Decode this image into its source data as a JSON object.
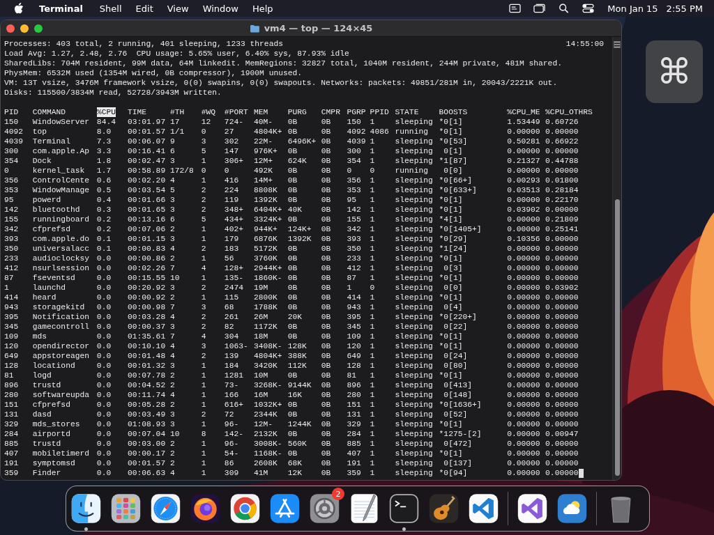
{
  "menubar": {
    "app": "Terminal",
    "menus": [
      "Shell",
      "Edit",
      "View",
      "Window",
      "Help"
    ],
    "date": "Mon Jan 15",
    "time": "2:55 PM"
  },
  "window": {
    "title": "vm4 — top — 124×45"
  },
  "terminal": {
    "summary": [
      "Processes: 403 total, 2 running, 401 sleeping, 1233 threads",
      "Load Avg: 1.27, 2.48, 2.76  CPU usage: 5.65% user, 6.40% sys, 87.93% idle",
      "SharedLibs: 704M resident, 99M data, 64M linkedit. MemRegions: 32827 total, 1040M resident, 244M private, 481M shared.",
      "PhysMem: 6532M used (1354M wired, 0B compressor), 1900M unused.",
      "VM: 13T vsize, 3476M framework vsize, 0(0) swapins, 0(0) swapouts. Networks: packets: 49851/281M in, 20043/2221K out.",
      "Disks: 115500/3834M read, 52728/3943M written."
    ],
    "clock": "14:55:00",
    "columns": [
      {
        "label": "PID",
        "selected": false
      },
      {
        "label": "COMMAND",
        "selected": false
      },
      {
        "label": "%CPU",
        "selected": true
      },
      {
        "label": "TIME",
        "selected": false
      },
      {
        "label": "#TH",
        "selected": false
      },
      {
        "label": "#WQ",
        "selected": false
      },
      {
        "label": "#PORT",
        "selected": false
      },
      {
        "label": "MEM",
        "selected": false
      },
      {
        "label": "PURG",
        "selected": false
      },
      {
        "label": "CMPR",
        "selected": false
      },
      {
        "label": "PGRP",
        "selected": false
      },
      {
        "label": "PPID",
        "selected": false
      },
      {
        "label": "STATE",
        "selected": false
      },
      {
        "label": "BOOSTS",
        "selected": false
      },
      {
        "label": "%CPU_ME",
        "selected": false
      },
      {
        "label": "%CPU_OTHRS",
        "selected": false
      }
    ],
    "rows": [
      [
        "150",
        "WindowServer",
        "84.4",
        "03:01.97",
        "17",
        "12",
        "724-",
        "40M-",
        "0B",
        "0B",
        "150",
        "1",
        "sleeping",
        "*0[1]",
        "1.53449",
        "0.60726"
      ],
      [
        "4092",
        "top",
        "8.0",
        "00:01.57",
        "1/1",
        "0",
        "27",
        "4804K+",
        "0B",
        "0B",
        "4092",
        "4086",
        "running",
        "*0[1]",
        "0.00000",
        "0.00000"
      ],
      [
        "4039",
        "Terminal",
        "7.3",
        "00:06.07",
        "9",
        "3",
        "302",
        "22M-",
        "6496K+",
        "0B",
        "4039",
        "1",
        "sleeping",
        "*0[53]",
        "0.50281",
        "0.66922"
      ],
      [
        "300",
        "com.apple.Ap",
        "3.3",
        "00:16.41",
        "6",
        "5",
        "147",
        "976K+",
        "0B",
        "0B",
        "300",
        "1",
        "sleeping",
        " 0[1]",
        "0.00000",
        "0.00000"
      ],
      [
        "354",
        "Dock",
        "1.8",
        "00:02.47",
        "3",
        "1",
        "306+",
        "12M+",
        "624K",
        "0B",
        "354",
        "1",
        "sleeping",
        "*1[87]",
        "0.21327",
        "0.44788"
      ],
      [
        "0",
        "kernel_task",
        "1.7",
        "00:58.89",
        "172/8",
        "0",
        "0",
        "492K",
        "0B",
        "0B",
        "0",
        "0",
        "running",
        " 0[0]",
        "0.00000",
        "0.00000"
      ],
      [
        "356",
        "ControlCente",
        "0.6",
        "00:02.20",
        "4",
        "1",
        "416",
        "14M+",
        "0B",
        "0B",
        "356",
        "1",
        "sleeping",
        "*0[66+]",
        "0.00293",
        "0.01800"
      ],
      [
        "353",
        "WindowManage",
        "0.5",
        "00:03.54",
        "5",
        "2",
        "224",
        "8808K",
        "0B",
        "0B",
        "353",
        "1",
        "sleeping",
        "*0[633+]",
        "0.03513",
        "0.28184"
      ],
      [
        "95",
        "powerd",
        "0.4",
        "00:01.66",
        "3",
        "2",
        "119",
        "1392K",
        "0B",
        "0B",
        "95",
        "1",
        "sleeping",
        "*0[1]",
        "0.00000",
        "0.22170"
      ],
      [
        "142",
        "bluetoothd",
        "0.3",
        "00:01.65",
        "3",
        "2",
        "348+",
        "6404K+",
        "40K",
        "0B",
        "142",
        "1",
        "sleeping",
        "*0[1]",
        "0.03902",
        "0.00000"
      ],
      [
        "155",
        "runningboard",
        "0.2",
        "00:13.16",
        "6",
        "5",
        "434+",
        "3324K+",
        "0B",
        "0B",
        "155",
        "1",
        "sleeping",
        "*4[1]",
        "0.00000",
        "0.21809"
      ],
      [
        "342",
        "cfprefsd",
        "0.2",
        "00:07.06",
        "2",
        "1",
        "402+",
        "944K+",
        "124K+",
        "0B",
        "342",
        "1",
        "sleeping",
        "*0[1405+]",
        "0.00000",
        "0.25141"
      ],
      [
        "393",
        "com.apple.do",
        "0.1",
        "00:01.15",
        "3",
        "1",
        "179",
        "6876K",
        "1392K",
        "0B",
        "393",
        "1",
        "sleeping",
        "*0[29]",
        "0.10356",
        "0.00000"
      ],
      [
        "350",
        "universalacc",
        "0.1",
        "00:00.83",
        "4",
        "2",
        "183",
        "5172K",
        "0B",
        "0B",
        "350",
        "1",
        "sleeping",
        "*1[24]",
        "0.00000",
        "0.00000"
      ],
      [
        "233",
        "audioclocksy",
        "0.0",
        "00:00.86",
        "2",
        "1",
        "56",
        "3760K",
        "0B",
        "0B",
        "233",
        "1",
        "sleeping",
        "*0[1]",
        "0.00000",
        "0.00000"
      ],
      [
        "412",
        "nsurlsession",
        "0.0",
        "00:02.26",
        "7",
        "4",
        "128+",
        "2944K+",
        "0B",
        "0B",
        "412",
        "1",
        "sleeping",
        " 0[3]",
        "0.00000",
        "0.00000"
      ],
      [
        "87",
        "fseventsd",
        "0.0",
        "00:15.55",
        "10",
        "1",
        "135-",
        "1860K-",
        "0B",
        "0B",
        "87",
        "1",
        "sleeping",
        "*0[1]",
        "0.00000",
        "0.00000"
      ],
      [
        "1",
        "launchd",
        "0.0",
        "00:20.92",
        "3",
        "2",
        "2474",
        "19M",
        "0B",
        "0B",
        "1",
        "0",
        "sleeping",
        " 0[0]",
        "0.00000",
        "0.03902"
      ],
      [
        "414",
        "heard",
        "0.0",
        "00:00.92",
        "2",
        "1",
        "115",
        "2800K",
        "0B",
        "0B",
        "414",
        "1",
        "sleeping",
        "*0[1]",
        "0.00000",
        "0.00000"
      ],
      [
        "943",
        "storagekitd",
        "0.0",
        "00:00.98",
        "7",
        "3",
        "68",
        "1788K",
        "0B",
        "0B",
        "943",
        "1",
        "sleeping",
        " 0[4]",
        "0.00000",
        "0.00000"
      ],
      [
        "395",
        "Notification",
        "0.0",
        "00:03.28",
        "4",
        "2",
        "261",
        "26M",
        "20K",
        "0B",
        "395",
        "1",
        "sleeping",
        "*0[220+]",
        "0.00000",
        "0.00000"
      ],
      [
        "345",
        "gamecontroll",
        "0.0",
        "00:00.37",
        "3",
        "2",
        "82",
        "1172K",
        "0B",
        "0B",
        "345",
        "1",
        "sleeping",
        " 0[22]",
        "0.00000",
        "0.00000"
      ],
      [
        "109",
        "mds",
        "0.0",
        "01:35.61",
        "7",
        "4",
        "304",
        "18M",
        "0B",
        "0B",
        "109",
        "1",
        "sleeping",
        "*0[1]",
        "0.00000",
        "0.00000"
      ],
      [
        "120",
        "opendirector",
        "0.0",
        "00:10.10",
        "4",
        "3",
        "1063-",
        "3408K-",
        "128K",
        "0B",
        "120",
        "1",
        "sleeping",
        "*0[1]",
        "0.00000",
        "0.00000"
      ],
      [
        "649",
        "appstoreagen",
        "0.0",
        "00:01.48",
        "4",
        "2",
        "139",
        "4804K+",
        "388K",
        "0B",
        "649",
        "1",
        "sleeping",
        " 0[24]",
        "0.00000",
        "0.00000"
      ],
      [
        "128",
        "locationd",
        "0.0",
        "00:01.32",
        "3",
        "1",
        "184",
        "3420K",
        "112K",
        "0B",
        "128",
        "1",
        "sleeping",
        " 0[80]",
        "0.00000",
        "0.00000"
      ],
      [
        "81",
        "logd",
        "0.0",
        "00:07.78",
        "2",
        "1",
        "1281",
        "10M",
        "0B",
        "0B",
        "81",
        "1",
        "sleeping",
        "*0[1]",
        "0.00000",
        "0.00000"
      ],
      [
        "896",
        "trustd",
        "0.0",
        "00:04.52",
        "2",
        "1",
        "73-",
        "3268K-",
        "9144K",
        "0B",
        "896",
        "1",
        "sleeping",
        " 0[413]",
        "0.00000",
        "0.00000"
      ],
      [
        "280",
        "softwareupda",
        "0.0",
        "00:11.74",
        "4",
        "1",
        "166",
        "16M",
        "16K",
        "0B",
        "280",
        "1",
        "sleeping",
        " 0[148]",
        "0.00000",
        "0.00000"
      ],
      [
        "151",
        "cfprefsd",
        "0.0",
        "00:05.28",
        "2",
        "1",
        "616+",
        "1032K+",
        "0B",
        "0B",
        "151",
        "1",
        "sleeping",
        "*0[1636+]",
        "0.00000",
        "0.00000"
      ],
      [
        "131",
        "dasd",
        "0.0",
        "00:03.49",
        "3",
        "2",
        "72",
        "2344K",
        "0B",
        "0B",
        "131",
        "1",
        "sleeping",
        " 0[52]",
        "0.00000",
        "0.00000"
      ],
      [
        "329",
        "mds_stores",
        "0.0",
        "01:08.93",
        "3",
        "1",
        "96-",
        "12M-",
        "1244K",
        "0B",
        "329",
        "1",
        "sleeping",
        "*0[1]",
        "0.00000",
        "0.00000"
      ],
      [
        "284",
        "airportd",
        "0.0",
        "00:07.04",
        "10",
        "8",
        "142-",
        "2132K",
        "0B",
        "0B",
        "284",
        "1",
        "sleeping",
        "*1275-[2]",
        "0.00000",
        "0.00947"
      ],
      [
        "885",
        "trustd",
        "0.0",
        "00:03.00",
        "2",
        "1",
        "96-",
        "3008K-",
        "560K",
        "0B",
        "885",
        "1",
        "sleeping",
        " 0[472]",
        "0.00000",
        "0.00000"
      ],
      [
        "407",
        "mobiletimerd",
        "0.0",
        "00:00.17",
        "2",
        "1",
        "54-",
        "1168K-",
        "0B",
        "0B",
        "407",
        "1",
        "sleeping",
        "*0[1]",
        "0.00000",
        "0.00000"
      ],
      [
        "191",
        "symptomsd",
        "0.0",
        "00:01.57",
        "2",
        "1",
        "86",
        "2608K",
        "68K",
        "0B",
        "191",
        "1",
        "sleeping",
        " 0[137]",
        "0.00000",
        "0.00000"
      ],
      [
        "359",
        "Finder",
        "0.0",
        "00:06.63",
        "4",
        "1",
        "309",
        "41M",
        "12K",
        "0B",
        "359",
        "1",
        "sleeping",
        "*0[94]",
        "0.00000",
        "0.00000"
      ]
    ]
  },
  "hud": {
    "symbol": "⌘"
  },
  "dock": [
    {
      "kind": "app",
      "running": true
    },
    {
      "kind": "app",
      "running": false
    },
    {
      "kind": "app",
      "running": false
    },
    {
      "kind": "app",
      "running": false
    },
    {
      "kind": "app",
      "running": false
    },
    {
      "kind": "app",
      "running": false
    },
    {
      "kind": "app",
      "running": false,
      "badge": "2"
    },
    {
      "kind": "app",
      "running": false
    },
    {
      "kind": "app",
      "running": true
    },
    {
      "kind": "app",
      "running": false
    },
    {
      "kind": "app",
      "running": false
    },
    {
      "kind": "separator"
    },
    {
      "kind": "app",
      "running": false
    },
    {
      "kind": "app",
      "running": false
    },
    {
      "kind": "separator"
    },
    {
      "kind": "app",
      "running": false
    }
  ]
}
